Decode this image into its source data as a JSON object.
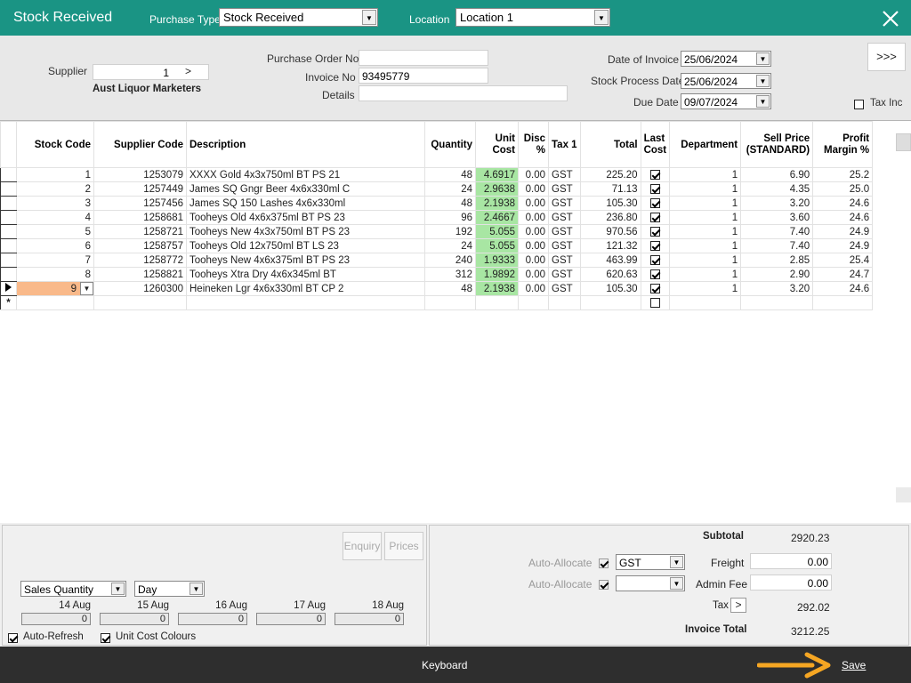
{
  "window": {
    "title": "Stock Received"
  },
  "toolbar": {
    "purchase_type_label": "Purchase Type",
    "purchase_type_value": "Stock Received",
    "location_label": "Location",
    "location_value": "Location 1"
  },
  "header": {
    "supplier_label": "Supplier",
    "supplier_value": "1",
    "supplier_button": ">",
    "supplier_name": "Aust Liquor Marketers",
    "po_label": "Purchase Order No",
    "po_value": "",
    "invoice_label": "Invoice No",
    "invoice_value": "93495779",
    "details_label": "Details",
    "details_value": "",
    "date_invoice_label": "Date of Invoice",
    "date_invoice_value": "25/06/2024",
    "stock_process_label": "Stock Process Date",
    "stock_process_value": "25/06/2024",
    "due_date_label": "Due Date",
    "due_date_value": "09/07/2024",
    "more_button": ">>>",
    "tax_inc_label": "Tax Inc"
  },
  "grid": {
    "columns": [
      "Stock Code",
      "Supplier Code",
      "Description",
      "Quantity",
      "Unit Cost",
      "Disc %",
      "Tax 1",
      "Total",
      "Last Cost",
      "Department",
      "Sell Price (STANDARD)",
      "Profit Margin %"
    ],
    "rows": [
      {
        "stock": "1",
        "supplier": "1253079",
        "desc": "XXXX Gold 4x3x750ml BT PS 21",
        "qty": "48",
        "unit": "4.6917",
        "disc": "0.00",
        "tax": "GST",
        "total": "225.20",
        "dept": "1",
        "sell": "6.90",
        "margin": "25.2"
      },
      {
        "stock": "2",
        "supplier": "1257449",
        "desc": "James SQ Gngr Beer 4x6x330ml C",
        "qty": "24",
        "unit": "2.9638",
        "disc": "0.00",
        "tax": "GST",
        "total": "71.13",
        "dept": "1",
        "sell": "4.35",
        "margin": "25.0"
      },
      {
        "stock": "3",
        "supplier": "1257456",
        "desc": "James SQ 150 Lashes 4x6x330ml",
        "qty": "48",
        "unit": "2.1938",
        "disc": "0.00",
        "tax": "GST",
        "total": "105.30",
        "dept": "1",
        "sell": "3.20",
        "margin": "24.6"
      },
      {
        "stock": "4",
        "supplier": "1258681",
        "desc": "Tooheys Old 4x6x375ml BT PS 23",
        "qty": "96",
        "unit": "2.4667",
        "disc": "0.00",
        "tax": "GST",
        "total": "236.80",
        "dept": "1",
        "sell": "3.60",
        "margin": "24.6"
      },
      {
        "stock": "5",
        "supplier": "1258721",
        "desc": "Tooheys New 4x3x750ml BT PS 23",
        "qty": "192",
        "unit": "5.055",
        "disc": "0.00",
        "tax": "GST",
        "total": "970.56",
        "dept": "1",
        "sell": "7.40",
        "margin": "24.9"
      },
      {
        "stock": "6",
        "supplier": "1258757",
        "desc": "Tooheys Old 12x750ml BT LS 23",
        "qty": "24",
        "unit": "5.055",
        "disc": "0.00",
        "tax": "GST",
        "total": "121.32",
        "dept": "1",
        "sell": "7.40",
        "margin": "24.9"
      },
      {
        "stock": "7",
        "supplier": "1258772",
        "desc": "Tooheys New 4x6x375ml BT PS 23",
        "qty": "240",
        "unit": "1.9333",
        "disc": "0.00",
        "tax": "GST",
        "total": "463.99",
        "dept": "1",
        "sell": "2.85",
        "margin": "25.4"
      },
      {
        "stock": "8",
        "supplier": "1258821",
        "desc": "Tooheys Xtra Dry 4x6x345ml BT",
        "qty": "312",
        "unit": "1.9892",
        "disc": "0.00",
        "tax": "GST",
        "total": "620.63",
        "dept": "1",
        "sell": "2.90",
        "margin": "24.7"
      },
      {
        "stock": "9",
        "supplier": "1260300",
        "desc": "Heineken Lgr 4x6x330ml BT CP 2",
        "qty": "48",
        "unit": "2.1938",
        "disc": "0.00",
        "tax": "GST",
        "total": "105.30",
        "dept": "1",
        "sell": "3.20",
        "margin": "24.6"
      }
    ],
    "new_row_marker": "*"
  },
  "bottom_left": {
    "enquiry_button": "Enquiry",
    "prices_button": "Prices",
    "metric_select": "Sales Quantity",
    "period_select": "Day",
    "days": [
      {
        "label": "14 Aug",
        "value": "0"
      },
      {
        "label": "15 Aug",
        "value": "0"
      },
      {
        "label": "16 Aug",
        "value": "0"
      },
      {
        "label": "17 Aug",
        "value": "0"
      },
      {
        "label": "18 Aug",
        "value": "0"
      }
    ],
    "auto_refresh_label": "Auto-Refresh",
    "unit_cost_colours_label": "Unit Cost Colours"
  },
  "bottom_right": {
    "subtotal_label": "Subtotal",
    "subtotal_value": "2920.23",
    "auto_allocate_label_1": "Auto-Allocate",
    "auto_allocate_label_2": "Auto-Allocate",
    "freight_tax_select": "GST",
    "admin_tax_select": "",
    "freight_label": "Freight",
    "freight_value": "0.00",
    "admin_fee_label": "Admin Fee",
    "admin_fee_value": "0.00",
    "tax_label": "Tax",
    "tax_button": ">",
    "tax_value": "292.02",
    "invoice_total_label": "Invoice Total",
    "invoice_total_value": "3212.25"
  },
  "footer": {
    "keyboard_label": "Keyboard",
    "save_label": "Save"
  },
  "colors": {
    "titlebar": "#1a9484",
    "unit_cost_highlight": "#a8e6a3",
    "selected_row": "#f9b98a",
    "arrow": "#f5a623",
    "footer": "#2e2e2e"
  }
}
